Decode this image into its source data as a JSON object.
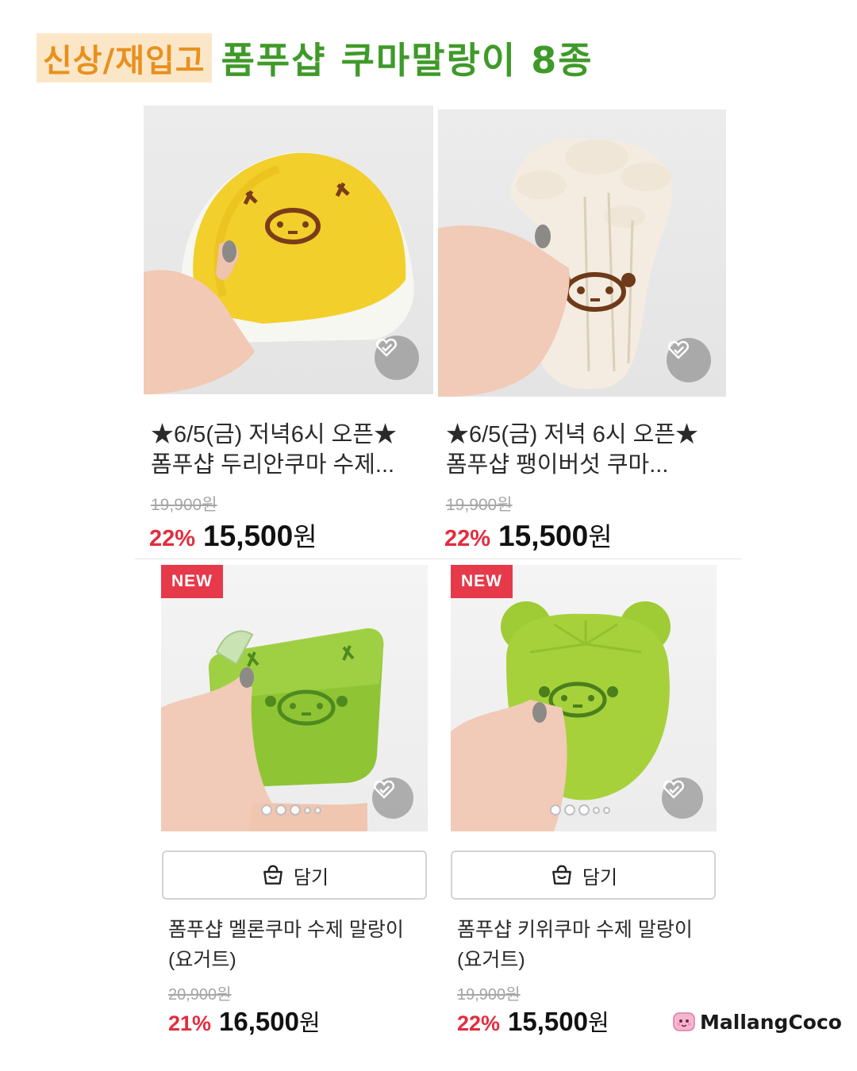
{
  "header": {
    "tag": "신상/재입고",
    "title": "폼푸샵 쿠마말랑이 8종"
  },
  "products": [
    {
      "title_line1": "★6/5(금) 저녁6시 오픈★",
      "title_line2": "폼푸샵 두리안쿠마 수제...",
      "original_price": "19,900원",
      "discount": "22%",
      "price": "15,500",
      "currency": "원"
    },
    {
      "title_line1": "★6/5(금) 저녁 6시 오픈★",
      "title_line2": "폼푸샵 팽이버섯 쿠마...",
      "original_price": "19,900원",
      "discount": "22%",
      "price": "15,500",
      "currency": "원"
    },
    {
      "badge": "NEW",
      "cart_label": "담기",
      "title_line1": "폼푸샵 멜론쿠마 수제 말랑이",
      "title_line2": "(요거트)",
      "original_price": "20,900원",
      "discount": "21%",
      "price": "16,500",
      "currency": "원"
    },
    {
      "badge": "NEW",
      "cart_label": "담기",
      "title_line1": "폼푸샵 키위쿠마 수제 말랑이",
      "title_line2": "(요거트)",
      "original_price": "19,900원",
      "discount": "22%",
      "price": "15,500",
      "currency": "원"
    }
  ],
  "brand": {
    "name": "MallangCoco"
  },
  "colors": {
    "tag_bg": "#fbe7c8",
    "tag_text": "#e9901e",
    "title_green": "#3f9a29",
    "discount_red": "#e32c3e",
    "badge_red": "#e6394a"
  },
  "icons": [
    "wishlist-heart-icon",
    "shopping-bag-icon",
    "brand-logo-icon"
  ],
  "carousel": {
    "slide_count": 5,
    "active_slide": 1
  }
}
